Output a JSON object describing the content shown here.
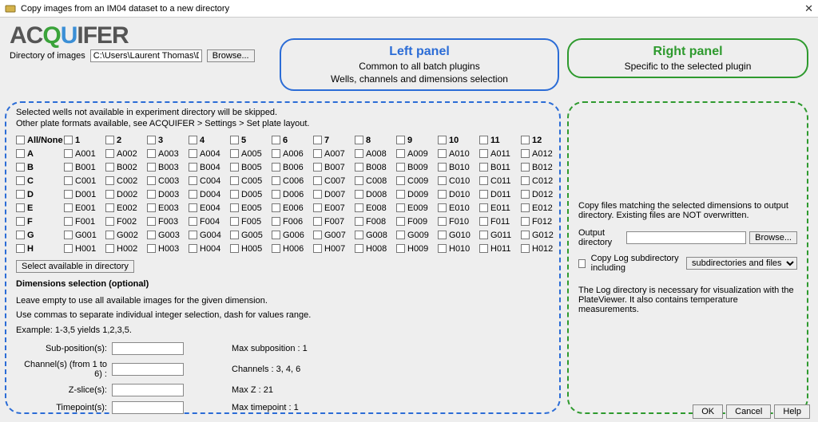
{
  "window": {
    "title": "Copy images from an IM04 dataset to a new directory"
  },
  "logo": {
    "part1": "AC",
    "part2": "Q",
    "part3": "U",
    "part4": "IFER"
  },
  "dir": {
    "label": "Directory of images",
    "value": "C:\\Users\\Laurent Thomas\\Do",
    "browse": "Browse..."
  },
  "callouts": {
    "left": {
      "title": "Left panel",
      "line1": "Common to all batch plugins",
      "line2": "Wells, channels and dimensions selection"
    },
    "right": {
      "title": "Right panel",
      "line1": "Specific to the selected plugin"
    }
  },
  "left_panel": {
    "hint1": "Selected wells not available in experiment directory will be skipped.",
    "hint2": "Other plate formats available, see ACQUIFER > Settings > Set plate layout.",
    "allnone": "All/None",
    "col_headers": [
      "1",
      "2",
      "3",
      "4",
      "5",
      "6",
      "7",
      "8",
      "9",
      "10",
      "11",
      "12"
    ],
    "row_labels": [
      "A",
      "B",
      "C",
      "D",
      "E",
      "F",
      "G",
      "H"
    ],
    "select_available": "Select available in directory",
    "dim_title": "Dimensions selection (optional)",
    "dim_hint1": "Leave empty to use all available images for the given dimension.",
    "dim_hint2": "Use commas to separate individual integer selection, dash for values range.",
    "dim_hint3": "Example: 1-3,5 yields 1,2,3,5.",
    "rows": {
      "subpos": {
        "label": "Sub-position(s):",
        "info": "Max subposition : 1"
      },
      "chan": {
        "label": "Channel(s) (from 1 to 6) :",
        "info": "Channels : 3, 4, 6"
      },
      "zslice": {
        "label": "Z-slice(s):",
        "info": "Max Z : 21"
      },
      "tpoint": {
        "label": "Timepoint(s):",
        "info": "Max timepoint : 1"
      }
    }
  },
  "right_panel": {
    "intro": "Copy files matching the selected dimensions to output directory. Existing files are NOT overwritten.",
    "outdir_label": "Output directory",
    "browse": "Browse...",
    "copylog_label": "Copy Log subdirectory including",
    "copylog_selected": "subdirectories and files",
    "footnote": "The Log directory is necessary for visualization with the PlateViewer. It also contains temperature measurements."
  },
  "buttons": {
    "ok": "OK",
    "cancel": "Cancel",
    "help": "Help"
  }
}
